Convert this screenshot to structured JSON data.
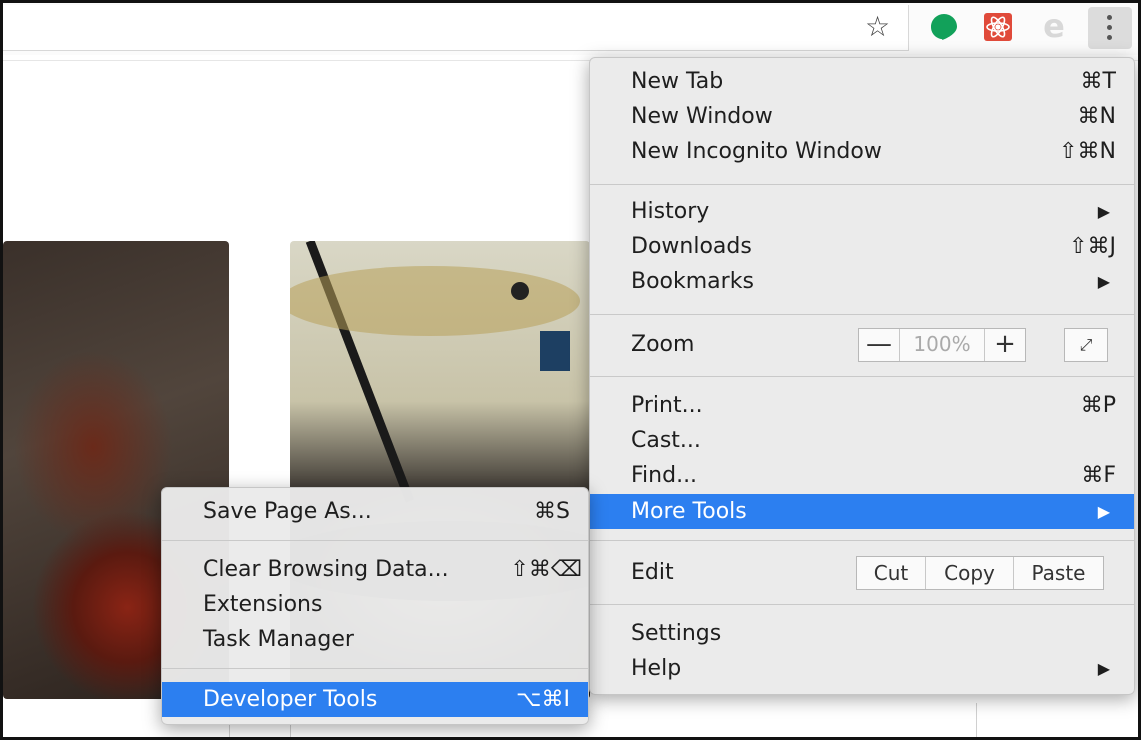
{
  "toolbar": {
    "star_icon": "☆",
    "extensions": [
      "hangouts-icon",
      "react-devtools-icon",
      "evernote-icon"
    ],
    "ext_e": "e",
    "menu_icon": "kebab-menu-icon",
    "accent": "#2c7ff0"
  },
  "main_menu": {
    "new_tab": {
      "label": "New Tab",
      "shortcut": "⌘T"
    },
    "new_window": {
      "label": "New Window",
      "shortcut": "⌘N"
    },
    "new_incognito": {
      "label": "New Incognito Window",
      "shortcut": "⇧⌘N"
    },
    "history": {
      "label": "History",
      "arrow": "▶"
    },
    "downloads": {
      "label": "Downloads",
      "shortcut": "⇧⌘J"
    },
    "bookmarks": {
      "label": "Bookmarks",
      "arrow": "▶"
    },
    "zoom": {
      "label": "Zoom",
      "minus": "—",
      "value": "100%",
      "plus": "+",
      "fullscreen": "⤢"
    },
    "print": {
      "label": "Print...",
      "shortcut": "⌘P"
    },
    "cast": {
      "label": "Cast..."
    },
    "find": {
      "label": "Find...",
      "shortcut": "⌘F"
    },
    "more_tools": {
      "label": "More Tools",
      "arrow": "▶"
    },
    "edit": {
      "label": "Edit",
      "cut": "Cut",
      "copy": "Copy",
      "paste": "Paste"
    },
    "settings": {
      "label": "Settings"
    },
    "help": {
      "label": "Help",
      "arrow": "▶"
    }
  },
  "sub_menu": {
    "save_page": {
      "label": "Save Page As...",
      "shortcut": "⌘S"
    },
    "clear_data": {
      "label": "Clear Browsing Data...",
      "shortcut": "⇧⌘⌫"
    },
    "extensions": {
      "label": "Extensions"
    },
    "task_manager": {
      "label": "Task Manager"
    },
    "developer_tools": {
      "label": "Developer Tools",
      "shortcut": "⌥⌘I"
    }
  }
}
